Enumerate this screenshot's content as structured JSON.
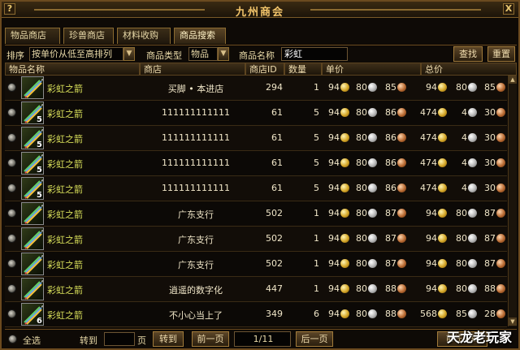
{
  "window": {
    "title": "九州商会",
    "help_label": "?",
    "close_label": "X"
  },
  "tabs": [
    {
      "label": "物品商店",
      "active": false
    },
    {
      "label": "珍兽商店",
      "active": false
    },
    {
      "label": "材料收购",
      "active": false
    },
    {
      "label": "商品搜索",
      "active": true
    }
  ],
  "filters": {
    "sort_label": "排序",
    "sort_value": "按单价从低至高排列",
    "type_label": "商品类型",
    "type_value": "物品",
    "name_label": "商品名称",
    "name_value": "彩虹",
    "search_label": "查找",
    "reset_label": "重置"
  },
  "columns": [
    "物品名称",
    "商店",
    "商店ID",
    "数量",
    "单价",
    "总价"
  ],
  "rows": [
    {
      "name": "彩虹之箭",
      "qty_badge": "",
      "shop": "买脚 • 本进店",
      "shop_id": "294",
      "count": "1",
      "unit": [
        "94",
        "80",
        "85"
      ],
      "total": [
        "94",
        "80",
        "85"
      ]
    },
    {
      "name": "彩虹之箭",
      "qty_badge": "5",
      "shop": "111111111111",
      "shop_id": "61",
      "count": "5",
      "unit": [
        "94",
        "80",
        "86"
      ],
      "total": [
        "474",
        "4",
        "30"
      ]
    },
    {
      "name": "彩虹之箭",
      "qty_badge": "5",
      "shop": "111111111111",
      "shop_id": "61",
      "count": "5",
      "unit": [
        "94",
        "80",
        "86"
      ],
      "total": [
        "474",
        "4",
        "30"
      ]
    },
    {
      "name": "彩虹之箭",
      "qty_badge": "5",
      "shop": "111111111111",
      "shop_id": "61",
      "count": "5",
      "unit": [
        "94",
        "80",
        "86"
      ],
      "total": [
        "474",
        "4",
        "30"
      ]
    },
    {
      "name": "彩虹之箭",
      "qty_badge": "5",
      "shop": "111111111111",
      "shop_id": "61",
      "count": "5",
      "unit": [
        "94",
        "80",
        "86"
      ],
      "total": [
        "474",
        "4",
        "30"
      ]
    },
    {
      "name": "彩虹之箭",
      "qty_badge": "",
      "shop": "广东支行",
      "shop_id": "502",
      "count": "1",
      "unit": [
        "94",
        "80",
        "87"
      ],
      "total": [
        "94",
        "80",
        "87"
      ]
    },
    {
      "name": "彩虹之箭",
      "qty_badge": "",
      "shop": "广东支行",
      "shop_id": "502",
      "count": "1",
      "unit": [
        "94",
        "80",
        "87"
      ],
      "total": [
        "94",
        "80",
        "87"
      ]
    },
    {
      "name": "彩虹之箭",
      "qty_badge": "",
      "shop": "广东支行",
      "shop_id": "502",
      "count": "1",
      "unit": [
        "94",
        "80",
        "87"
      ],
      "total": [
        "94",
        "80",
        "87"
      ]
    },
    {
      "name": "彩虹之箭",
      "qty_badge": "",
      "shop": "逍遥的数字化",
      "shop_id": "447",
      "count": "1",
      "unit": [
        "94",
        "80",
        "88"
      ],
      "total": [
        "94",
        "80",
        "88"
      ]
    },
    {
      "name": "彩虹之箭",
      "qty_badge": "6",
      "shop": "不小心当上了",
      "shop_id": "349",
      "count": "6",
      "unit": [
        "94",
        "80",
        "88"
      ],
      "total": [
        "568",
        "85",
        "28"
      ]
    }
  ],
  "footer": {
    "select_all_label": "全选",
    "goto_label": "转到",
    "page_unit_label": "页",
    "goto_button_label": "转到",
    "prev_label": "前一页",
    "page_indicator": "1/11",
    "next_label": "后一页",
    "visit_label": "前往店铺"
  },
  "watermark": "天龙老玩家",
  "colors": {
    "item_name": "#d9e05a",
    "border": "#8a6a30",
    "title": "#f2c46a"
  },
  "icons": {
    "coin_gold": "gold-coin-icon",
    "coin_silver": "silver-coin-icon",
    "coin_copper": "copper-coin-icon",
    "item": "rainbow-arrow-icon"
  }
}
